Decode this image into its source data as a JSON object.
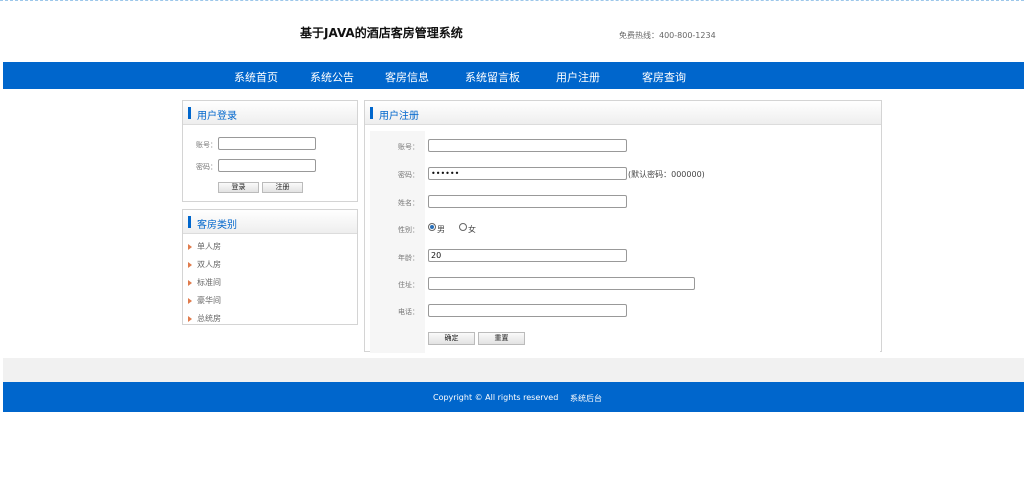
{
  "header": {
    "site_title": "基于JAVA的酒店客房管理系统",
    "hotline": "免费热线：400-800-1234"
  },
  "nav": {
    "items": [
      "系统首页",
      "系统公告",
      "客房信息",
      "系统留言板",
      "用户注册",
      "客房查询"
    ]
  },
  "login": {
    "title": "用户登录",
    "account_label": "账号：",
    "account_value": "",
    "password_label": "密码：",
    "password_value": "",
    "login_button": "登录",
    "register_button": "注册"
  },
  "categories": {
    "title": "客房类别",
    "items": [
      "单人房",
      "双人房",
      "标准间",
      "豪华间",
      "总统房"
    ]
  },
  "register": {
    "title": "用户注册",
    "account_label": "账号：",
    "account_value": "",
    "password_label": "密码：",
    "password_value": "••••••",
    "password_hint": "(默认密码：000000)",
    "name_label": "姓名：",
    "name_value": "",
    "gender_label": "性别：",
    "gender_options": [
      "男",
      "女"
    ],
    "gender_selected": "男",
    "age_label": "年龄：",
    "age_value": "20",
    "address_label": "住址：",
    "address_value": "",
    "phone_label": "电话：",
    "phone_value": "",
    "confirm_button": "确定",
    "reset_button": "重置"
  },
  "footer": {
    "copyright": "Copyright © All rights reserved",
    "admin_link": "系统后台"
  },
  "colors": {
    "brand_blue": "#0066cc",
    "category_arrow": "#e07b4c"
  }
}
